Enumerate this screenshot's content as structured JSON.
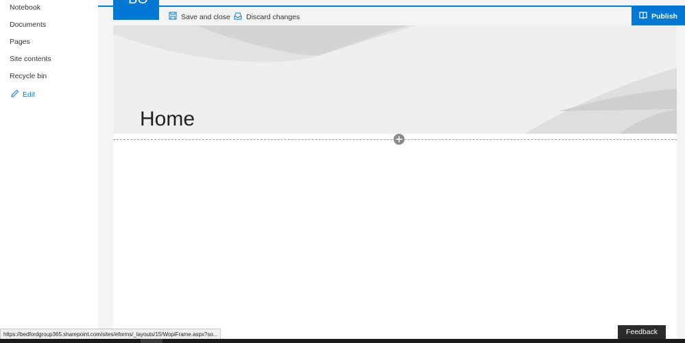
{
  "nav": {
    "items": [
      {
        "label": "Notebook"
      },
      {
        "label": "Documents"
      },
      {
        "label": "Pages"
      },
      {
        "label": "Site contents"
      },
      {
        "label": "Recycle bin"
      }
    ],
    "edit_label": "Edit"
  },
  "site": {
    "logo_text": "BO"
  },
  "toolbar": {
    "save_label": "Save and close",
    "discard_label": "Discard changes",
    "publish_label": "Publish"
  },
  "page": {
    "title": "Home"
  },
  "status": {
    "url": "https://bedfordgroup365.sharepoint.com/sites/eforms/_layouts/15/WopiFrame.aspx?so..."
  },
  "feedback": {
    "label": "Feedback"
  },
  "colors": {
    "accent": "#0078d4",
    "hero_bg": "#efefef",
    "feedback_bg": "#2b2b2b"
  },
  "icons": {
    "save": "save-icon",
    "discard": "discard-icon",
    "publish": "publish-icon",
    "edit": "pencil-icon",
    "add": "plus-icon"
  }
}
